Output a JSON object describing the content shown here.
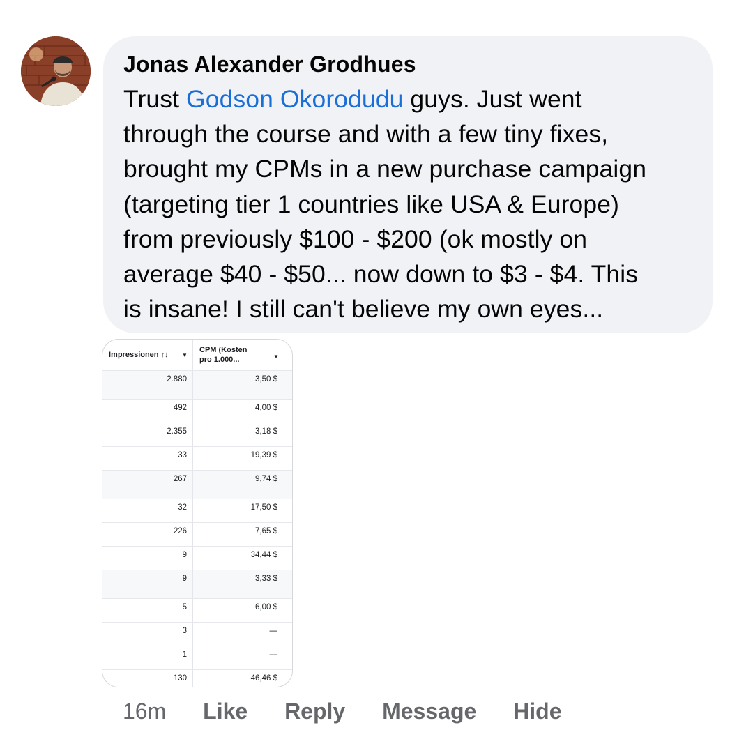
{
  "comment": {
    "author": "Jonas Alexander Grodhues",
    "text_before_mention": "Trust ",
    "mention": "Godson Okorodudu",
    "text_after_mention": " guys. Just went\nthrough the course and with a few tiny fixes,\nbrought my CPMs in a new purchase campaign\n(targeting tier 1 countries like USA & Europe)\nfrom previously $100 - $200 (ok mostly on\naverage $40 - $50... now down to $3 - $4. This\nis insane! I still can't believe my own eyes...",
    "colors": {
      "bubble_bg": "#f0f2f5",
      "mention": "#1a6ed8",
      "meta": "#65676b"
    }
  },
  "attachment_table": {
    "headers": {
      "impressions": "Impressionen ↑↓",
      "cpm_line1": "CPM (Kosten",
      "cpm_line2": "pro 1.000..."
    },
    "rows": [
      {
        "impressions": "2.880",
        "cpm": "3,50 $",
        "shaded": true
      },
      {
        "impressions": "492",
        "cpm": "4,00 $",
        "shaded": false
      },
      {
        "impressions": "2.355",
        "cpm": "3,18 $",
        "shaded": false
      },
      {
        "impressions": "33",
        "cpm": "19,39 $",
        "shaded": false
      },
      {
        "impressions": "267",
        "cpm": "9,74 $",
        "shaded": true
      },
      {
        "impressions": "32",
        "cpm": "17,50 $",
        "shaded": false
      },
      {
        "impressions": "226",
        "cpm": "7,65 $",
        "shaded": false
      },
      {
        "impressions": "9",
        "cpm": "34,44 $",
        "shaded": false
      },
      {
        "impressions": "9",
        "cpm": "3,33 $",
        "shaded": true
      },
      {
        "impressions": "5",
        "cpm": "6,00 $",
        "shaded": false
      },
      {
        "impressions": "3",
        "cpm": "—",
        "shaded": false
      },
      {
        "impressions": "1",
        "cpm": "—",
        "shaded": false
      },
      {
        "impressions": "130",
        "cpm": "46,46 $",
        "shaded": false
      }
    ]
  },
  "actions": {
    "time": "16m",
    "like": "Like",
    "reply": "Reply",
    "message": "Message",
    "hide": "Hide"
  }
}
